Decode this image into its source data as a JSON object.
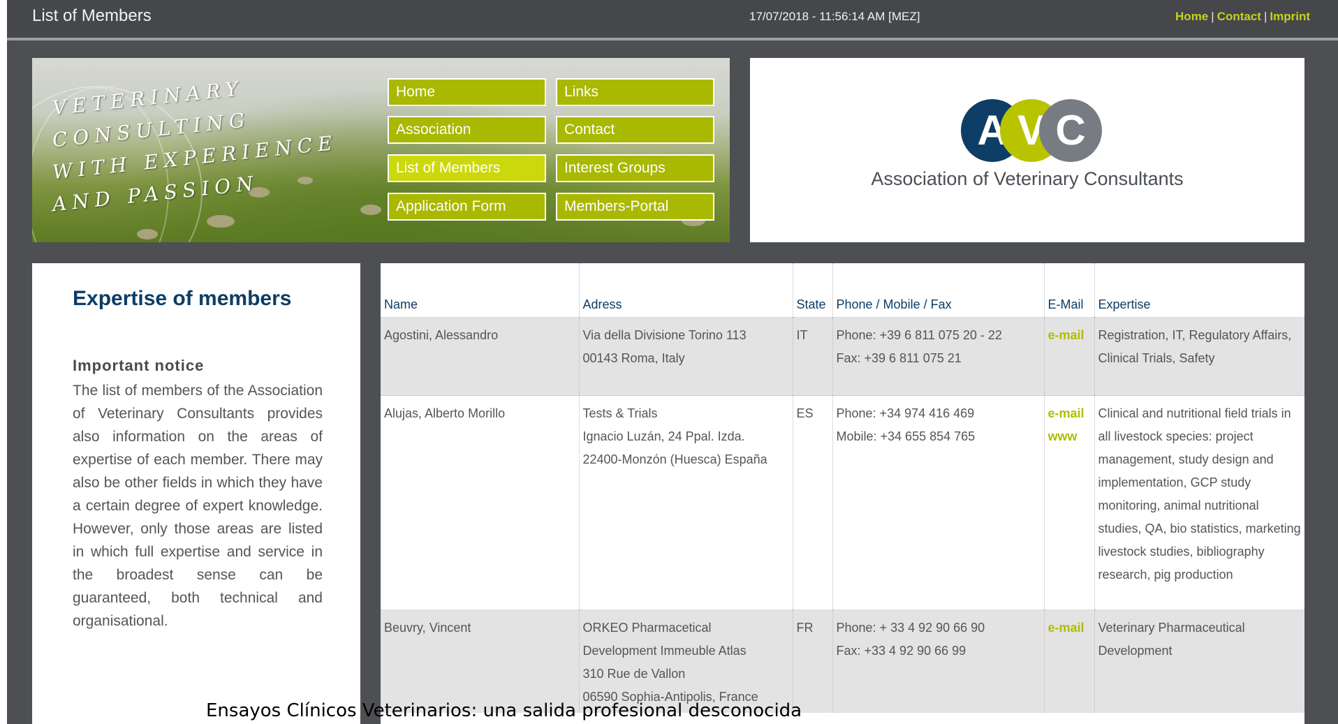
{
  "header": {
    "title": "List of Members",
    "datetime": "17/07/2018 - 11:56:14 AM [MEZ]",
    "links": [
      "Home",
      "Contact",
      "Imprint"
    ],
    "link_color": "#c5d21b"
  },
  "banner": {
    "tagline": [
      "Veterinary",
      "consulting",
      "with experience",
      "and passion"
    ],
    "nav": [
      "Home",
      "Links",
      "Association",
      "Contact",
      "List of Members",
      "Interest Groups",
      "Application Form",
      "Members-Portal"
    ],
    "active_nav": "List of Members",
    "nav_color": "#a9b800"
  },
  "logo": {
    "letters": [
      "A",
      "V",
      "C"
    ],
    "text": "Association of Veterinary Consultants",
    "colors": [
      "#0e3d66",
      "#b8c400",
      "#767c82"
    ]
  },
  "sidebar": {
    "heading": "Expertise of members",
    "notice_title": "Important notice",
    "notice_body": "The list of members of the Association of Veterinary Consultants provides also information on the areas of expertise of each member. There may also be other fields in which they have a certain degree of expert knowledge. However, only those areas are listed in which full expertise and service in the broadest sense can be guaranteed, both technical and organisational."
  },
  "table": {
    "headers": [
      "Name",
      "Adress",
      "State",
      "Phone / Mobile / Fax",
      "E-Mail",
      "Expertise"
    ],
    "rows": [
      {
        "name": "Agostini, Alessandro",
        "address": [
          "Via della Divisione Torino 113",
          "00143 Roma, Italy"
        ],
        "state": "IT",
        "phone": [
          "Phone: +39 6 811 075 20 - 22",
          "Fax: +39 6 811 075 21"
        ],
        "email": [
          "e-mail"
        ],
        "expertise": "Registration, IT, Regulatory Affairs, Clinical Trials, Safety"
      },
      {
        "name": "Alujas, Alberto Morillo",
        "address": [
          "Tests & Trials",
          "Ignacio Luzán, 24 Ppal. Izda.",
          "22400-Monzón (Huesca) España"
        ],
        "state": "ES",
        "phone": [
          "Phone: +34 974 416 469",
          "Mobile: +34 655 854 765"
        ],
        "email": [
          "e-mail",
          "www"
        ],
        "expertise": "Clinical and nutritional field trials in all livestock species: project management, study design and implementation, GCP study monitoring, animal nutritional studies, QA, bio statistics, marketing livestock studies, bibliography research, pig production"
      },
      {
        "name": "Beuvry, Vincent",
        "address": [
          "ORKEO Pharmacetical Development Immeuble Atlas",
          "310 Rue de Vallon",
          "06590 Sophia-Antipolis, France"
        ],
        "state": "FR",
        "phone": [
          "Phone: + 33 4 92 90 66 90",
          "Fax: +33 4 92 90 66 99"
        ],
        "email": [
          "e-mail"
        ],
        "expertise": "Veterinary Pharmaceutical Development"
      }
    ]
  },
  "caption": "Ensayos Clínicos Veterinarios: una salida profesional desconocida"
}
